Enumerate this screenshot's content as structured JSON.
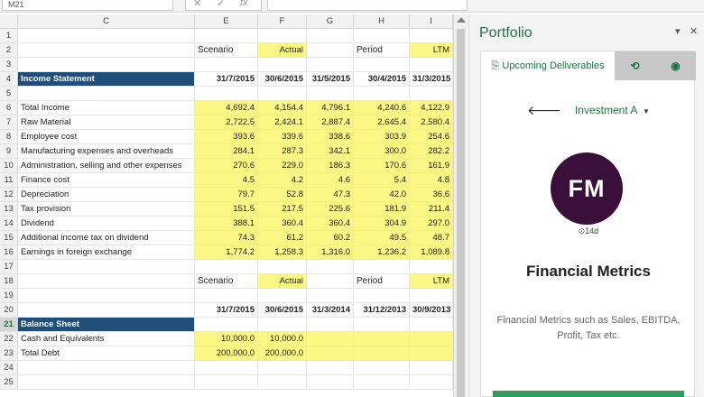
{
  "formula_bar": {
    "name_box": "M21",
    "cancel_icon": "✕",
    "enter_icon": "✓",
    "fx_label": "fx"
  },
  "columns": [
    "C",
    "E",
    "F",
    "G",
    "H",
    "I"
  ],
  "rows": [
    {
      "n": "1",
      "cells": []
    },
    {
      "n": "2",
      "cells": [
        {
          "col": "E",
          "v": "Scenario",
          "lbl": true
        },
        {
          "col": "F",
          "v": "Actual",
          "yl": true,
          "right": true
        },
        {
          "col": "H",
          "v": "Period",
          "lbl": true
        },
        {
          "col": "I",
          "v": "LTM",
          "yl": true,
          "right": true
        }
      ]
    },
    {
      "n": "3",
      "cells": []
    },
    {
      "n": "4",
      "cells": [
        {
          "col": "C",
          "v": "Income Statement",
          "blue": true
        },
        {
          "col": "E",
          "v": "31/7/2015",
          "bold": true,
          "right": true
        },
        {
          "col": "F",
          "v": "30/6/2015",
          "bold": true,
          "right": true
        },
        {
          "col": "G",
          "v": "31/5/2015",
          "bold": true,
          "right": true
        },
        {
          "col": "H",
          "v": "30/4/2015",
          "bold": true,
          "right": true
        },
        {
          "col": "I",
          "v": "31/3/2015",
          "bold": true,
          "right": true
        }
      ]
    },
    {
      "n": "5",
      "cells": []
    },
    {
      "n": "6",
      "cells": [
        {
          "col": "C",
          "v": "Total Income"
        },
        {
          "col": "E",
          "v": "4,692.4",
          "yl": true,
          "right": true
        },
        {
          "col": "F",
          "v": "4,154.4",
          "yl": true,
          "right": true
        },
        {
          "col": "G",
          "v": "4,796.1",
          "yl": true,
          "right": true
        },
        {
          "col": "H",
          "v": "4,240.6",
          "yl": true,
          "right": true
        },
        {
          "col": "I",
          "v": "4,122.9",
          "yl": true,
          "right": true
        }
      ]
    },
    {
      "n": "7",
      "cells": [
        {
          "col": "C",
          "v": "Raw Material"
        },
        {
          "col": "E",
          "v": "2,722.5",
          "yl": true,
          "right": true
        },
        {
          "col": "F",
          "v": "2,424.1",
          "yl": true,
          "right": true
        },
        {
          "col": "G",
          "v": "2,887.4",
          "yl": true,
          "right": true
        },
        {
          "col": "H",
          "v": "2,645.4",
          "yl": true,
          "right": true
        },
        {
          "col": "I",
          "v": "2,580.4",
          "yl": true,
          "right": true
        }
      ]
    },
    {
      "n": "8",
      "cells": [
        {
          "col": "C",
          "v": "Employee cost"
        },
        {
          "col": "E",
          "v": "393.6",
          "yl": true,
          "right": true
        },
        {
          "col": "F",
          "v": "339.6",
          "yl": true,
          "right": true
        },
        {
          "col": "G",
          "v": "338.6",
          "yl": true,
          "right": true
        },
        {
          "col": "H",
          "v": "303.9",
          "yl": true,
          "right": true
        },
        {
          "col": "I",
          "v": "254.6",
          "yl": true,
          "right": true
        }
      ]
    },
    {
      "n": "9",
      "cells": [
        {
          "col": "C",
          "v": "Manufacturing expenses and overheads"
        },
        {
          "col": "E",
          "v": "284.1",
          "yl": true,
          "right": true
        },
        {
          "col": "F",
          "v": "287.3",
          "yl": true,
          "right": true
        },
        {
          "col": "G",
          "v": "342.1",
          "yl": true,
          "right": true
        },
        {
          "col": "H",
          "v": "300.0",
          "yl": true,
          "right": true
        },
        {
          "col": "I",
          "v": "282.2",
          "yl": true,
          "right": true
        }
      ]
    },
    {
      "n": "10",
      "cells": [
        {
          "col": "C",
          "v": "Administration, selling and other expenses"
        },
        {
          "col": "E",
          "v": "270.6",
          "yl": true,
          "right": true
        },
        {
          "col": "F",
          "v": "229.0",
          "yl": true,
          "right": true
        },
        {
          "col": "G",
          "v": "186.3",
          "yl": true,
          "right": true
        },
        {
          "col": "H",
          "v": "170.6",
          "yl": true,
          "right": true
        },
        {
          "col": "I",
          "v": "161.9",
          "yl": true,
          "right": true
        }
      ]
    },
    {
      "n": "11",
      "cells": [
        {
          "col": "C",
          "v": "Finance cost"
        },
        {
          "col": "E",
          "v": "4.5",
          "yl": true,
          "right": true
        },
        {
          "col": "F",
          "v": "4.2",
          "yl": true,
          "right": true
        },
        {
          "col": "G",
          "v": "4.6",
          "yl": true,
          "right": true
        },
        {
          "col": "H",
          "v": "5.4",
          "yl": true,
          "right": true
        },
        {
          "col": "I",
          "v": "4.8",
          "yl": true,
          "right": true
        }
      ]
    },
    {
      "n": "12",
      "cells": [
        {
          "col": "C",
          "v": "Depreciation"
        },
        {
          "col": "E",
          "v": "79.7",
          "yl": true,
          "right": true
        },
        {
          "col": "F",
          "v": "52.8",
          "yl": true,
          "right": true
        },
        {
          "col": "G",
          "v": "47.3",
          "yl": true,
          "right": true
        },
        {
          "col": "H",
          "v": "42.0",
          "yl": true,
          "right": true
        },
        {
          "col": "I",
          "v": "36.6",
          "yl": true,
          "right": true
        }
      ]
    },
    {
      "n": "13",
      "cells": [
        {
          "col": "C",
          "v": "Tax provision"
        },
        {
          "col": "E",
          "v": "151.5",
          "yl": true,
          "right": true
        },
        {
          "col": "F",
          "v": "217.5",
          "yl": true,
          "right": true
        },
        {
          "col": "G",
          "v": "225.6",
          "yl": true,
          "right": true
        },
        {
          "col": "H",
          "v": "181.9",
          "yl": true,
          "right": true
        },
        {
          "col": "I",
          "v": "211.4",
          "yl": true,
          "right": true
        }
      ]
    },
    {
      "n": "14",
      "cells": [
        {
          "col": "C",
          "v": "Dividend"
        },
        {
          "col": "E",
          "v": "388.1",
          "yl": true,
          "right": true
        },
        {
          "col": "F",
          "v": "360.4",
          "yl": true,
          "right": true
        },
        {
          "col": "G",
          "v": "360.4",
          "yl": true,
          "right": true
        },
        {
          "col": "H",
          "v": "304.9",
          "yl": true,
          "right": true
        },
        {
          "col": "I",
          "v": "297.0",
          "yl": true,
          "right": true
        }
      ]
    },
    {
      "n": "15",
      "cells": [
        {
          "col": "C",
          "v": "Additional income tax on dividend"
        },
        {
          "col": "E",
          "v": "74.3",
          "yl": true,
          "right": true
        },
        {
          "col": "F",
          "v": "61.2",
          "yl": true,
          "right": true
        },
        {
          "col": "G",
          "v": "60.2",
          "yl": true,
          "right": true
        },
        {
          "col": "H",
          "v": "49.5",
          "yl": true,
          "right": true
        },
        {
          "col": "I",
          "v": "48.7",
          "yl": true,
          "right": true
        }
      ]
    },
    {
      "n": "16",
      "cells": [
        {
          "col": "C",
          "v": "Earnings in foreign exchange"
        },
        {
          "col": "E",
          "v": "1,774.2",
          "yl": true,
          "right": true
        },
        {
          "col": "F",
          "v": "1,258.3",
          "yl": true,
          "right": true
        },
        {
          "col": "G",
          "v": "1,316.0",
          "yl": true,
          "right": true
        },
        {
          "col": "H",
          "v": "1,236.2",
          "yl": true,
          "right": true
        },
        {
          "col": "I",
          "v": "1,089.8",
          "yl": true,
          "right": true
        }
      ]
    },
    {
      "n": "17",
      "cells": []
    },
    {
      "n": "18",
      "cells": [
        {
          "col": "E",
          "v": "Scenario",
          "lbl": true
        },
        {
          "col": "F",
          "v": "Actual",
          "yl": true,
          "right": true
        },
        {
          "col": "H",
          "v": "Period",
          "lbl": true
        },
        {
          "col": "I",
          "v": "LTM",
          "yl": true,
          "right": true
        }
      ]
    },
    {
      "n": "19",
      "cells": []
    },
    {
      "n": "20",
      "cells": [
        {
          "col": "E",
          "v": "31/7/2015",
          "bold": true,
          "right": true
        },
        {
          "col": "F",
          "v": "30/6/2015",
          "bold": true,
          "right": true
        },
        {
          "col": "G",
          "v": "31/3/2014",
          "bold": true,
          "right": true
        },
        {
          "col": "H",
          "v": "31/12/2013",
          "bold": true,
          "right": true
        },
        {
          "col": "I",
          "v": "30/9/2013",
          "bold": true,
          "right": true
        }
      ]
    },
    {
      "n": "21",
      "sel": true,
      "cells": [
        {
          "col": "C",
          "v": "Balance Sheet",
          "blue": true
        }
      ]
    },
    {
      "n": "22",
      "cells": [
        {
          "col": "C",
          "v": "Cash and Equivalents"
        },
        {
          "col": "E",
          "v": "10,000.0",
          "yl": true,
          "right": true
        },
        {
          "col": "F",
          "v": "10,000.0",
          "yl": true,
          "right": true
        },
        {
          "col": "G",
          "v": "",
          "yl": true
        },
        {
          "col": "H",
          "v": "",
          "yl": true
        },
        {
          "col": "I",
          "v": "",
          "yl": true
        }
      ]
    },
    {
      "n": "23",
      "cells": [
        {
          "col": "C",
          "v": "Total Debt"
        },
        {
          "col": "E",
          "v": "200,000.0",
          "yl": true,
          "right": true
        },
        {
          "col": "F",
          "v": "200,000.0",
          "yl": true,
          "right": true
        },
        {
          "col": "G",
          "v": "",
          "yl": true
        },
        {
          "col": "H",
          "v": "",
          "yl": true
        },
        {
          "col": "I",
          "v": "",
          "yl": true
        }
      ]
    },
    {
      "n": "24",
      "cells": []
    },
    {
      "n": "25",
      "cells": []
    }
  ],
  "pane": {
    "title": "Portfolio",
    "menu_icon": "▾",
    "close_icon": "✕",
    "tabs": {
      "deliverables_icon": "⎘",
      "deliverables_label": "Upcoming Deliverables",
      "refresh_icon": "⟲",
      "globe_icon": "◉"
    },
    "investment": {
      "back_icon": "🡐",
      "label": "Investment A",
      "caret": "▼"
    },
    "avatar_initials": "FM",
    "age_text": "⊙14d",
    "card_title": "Financial Metrics",
    "card_description": "Financial Metrics such as Sales, EBITDA, Profit, Tax etc."
  }
}
